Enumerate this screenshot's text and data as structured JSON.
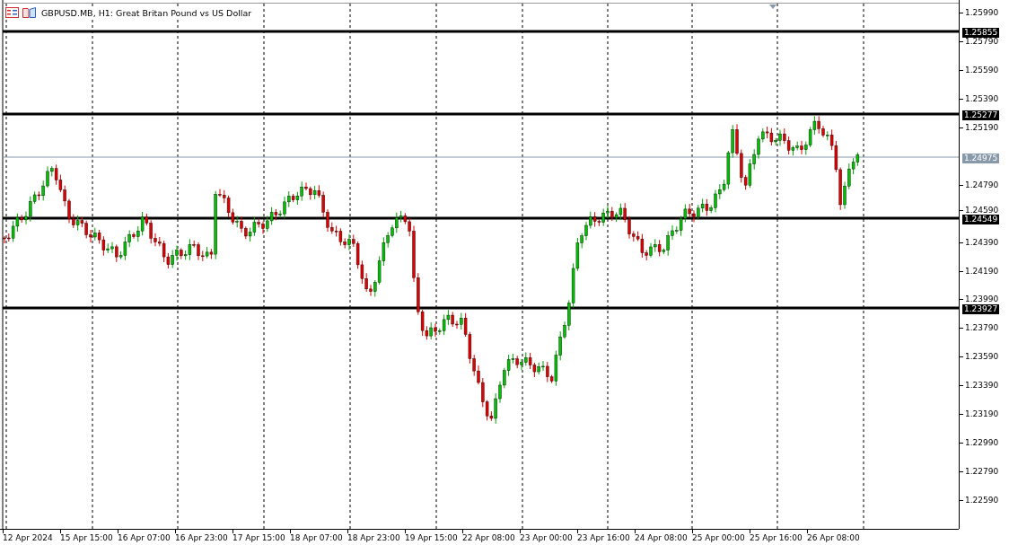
{
  "title": "GBPUSD.MB, H1:  Great Britan Pound vs US Dollar",
  "price_axis": [
    "1.25990",
    "1.25790",
    "1.25590",
    "1.25390",
    "1.25190",
    "1.24790",
    "1.24590",
    "1.24390",
    "1.24190",
    "1.23990",
    "1.23790",
    "1.23590",
    "1.23390",
    "1.23190",
    "1.22990",
    "1.22790",
    "1.22590"
  ],
  "levels": [
    {
      "label": "1.25855",
      "kind": "line"
    },
    {
      "label": "1.25277",
      "kind": "line"
    },
    {
      "label": "1.24975",
      "kind": "bid"
    },
    {
      "label": "1.24549",
      "kind": "line"
    },
    {
      "label": "1.23927",
      "kind": "line"
    }
  ],
  "time_axis": [
    "12 Apr 2024",
    "15 Apr 15:00",
    "16 Apr 07:00",
    "16 Apr 23:00",
    "17 Apr 15:00",
    "18 Apr 07:00",
    "18 Apr 23:00",
    "19 Apr 15:00",
    "22 Apr 08:00",
    "23 Apr 00:00",
    "23 Apr 16:00",
    "24 Apr 08:00",
    "25 Apr 00:00",
    "25 Apr 16:00",
    "26 Apr 08:00"
  ]
}
